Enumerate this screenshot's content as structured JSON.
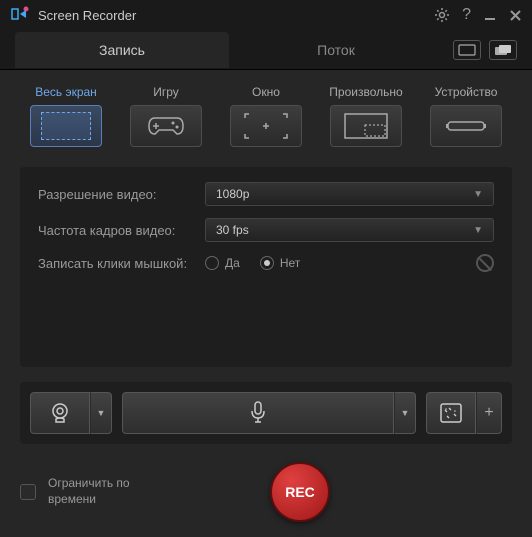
{
  "app": {
    "title": "Screen Recorder"
  },
  "tabs": {
    "record": "Запись",
    "stream": "Поток"
  },
  "modes": {
    "fullscreen": "Весь экран",
    "game": "Игру",
    "window": "Окно",
    "custom": "Произвольно",
    "device": "Устройство"
  },
  "settings": {
    "resolution_label": "Разрешение видео:",
    "resolution_value": "1080p",
    "fps_label": "Частота кадров видео:",
    "fps_value": "30 fps",
    "clicks_label": "Записать клики мышкой:",
    "yes": "Да",
    "no": "Нет"
  },
  "bottom": {
    "limit_label": "Ограничить по времени",
    "rec": "REC"
  }
}
